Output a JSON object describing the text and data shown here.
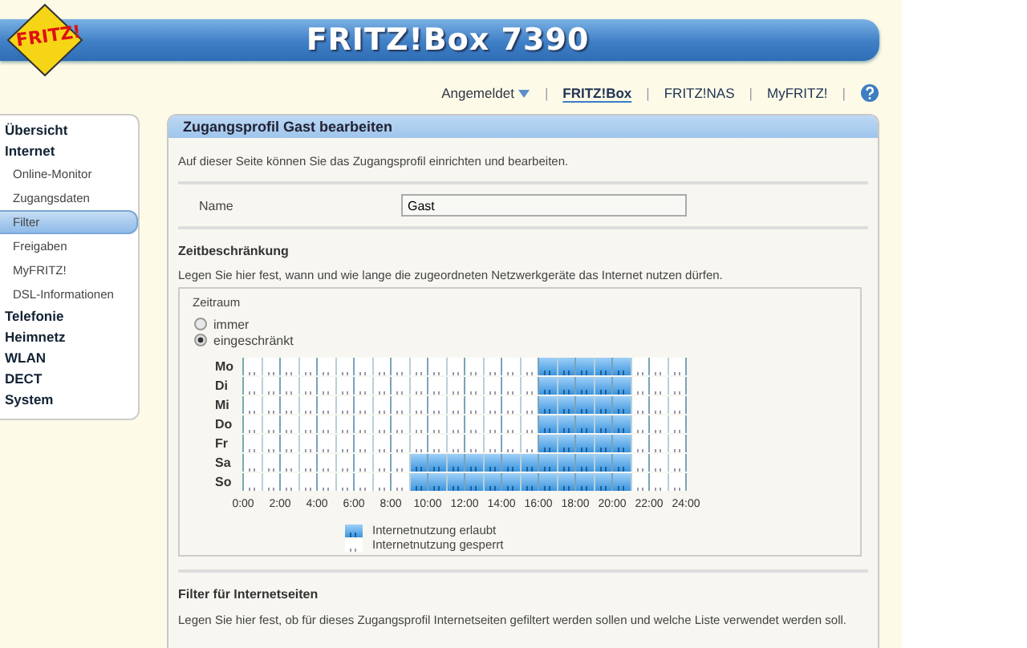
{
  "header": {
    "logo": "FRITZ!",
    "title": "FRITZ!Box 7390"
  },
  "top_nav": {
    "account": "Angemeldet",
    "separators": [
      "|",
      "|",
      "|",
      "|"
    ],
    "links": [
      {
        "label": "FRITZ!Box",
        "selected": true
      },
      {
        "label": "FRITZ!NAS",
        "selected": false
      },
      {
        "label": "MyFRITZ!",
        "selected": false
      }
    ]
  },
  "sidebar": {
    "items": [
      {
        "label": "Übersicht",
        "selected": false
      },
      {
        "label": "Internet",
        "selected": false,
        "children": [
          {
            "label": "Online-Monitor",
            "selected": false
          },
          {
            "label": "Zugangsdaten",
            "selected": false
          },
          {
            "label": "Filter",
            "selected": true
          },
          {
            "label": "Freigaben",
            "selected": false
          },
          {
            "label": "MyFRITZ!",
            "selected": false
          },
          {
            "label": "DSL-Informationen",
            "selected": false
          }
        ]
      },
      {
        "label": "Telefonie",
        "selected": false
      },
      {
        "label": "Heimnetz",
        "selected": false
      },
      {
        "label": "WLAN",
        "selected": false
      },
      {
        "label": "DECT",
        "selected": false
      },
      {
        "label": "System",
        "selected": false
      }
    ]
  },
  "panel": {
    "title": "Zugangsprofil Gast bearbeiten",
    "intro": "Auf dieser Seite können Sie das Zugangsprofil einrichten und bearbeiten.",
    "name_field": {
      "label": "Name",
      "value": "Gast"
    },
    "time_section": {
      "heading": "Zeitbeschränkung",
      "description": "Legen Sie hier fest, wann und wie lange die zugeordneten Netzwerkgeräte das Internet nutzen dürfen.",
      "period_label": "Zeitraum",
      "options": [
        {
          "label": "immer",
          "selected": false
        },
        {
          "label": "eingeschränkt",
          "selected": true
        }
      ],
      "days": [
        {
          "day": "Mo",
          "slots": [
            false,
            false,
            false,
            false,
            false,
            false,
            false,
            false,
            false,
            false,
            false,
            false,
            false,
            false,
            false,
            false,
            true,
            true,
            true,
            true,
            true,
            false,
            false,
            false
          ]
        },
        {
          "day": "Di",
          "slots": [
            false,
            false,
            false,
            false,
            false,
            false,
            false,
            false,
            false,
            false,
            false,
            false,
            false,
            false,
            false,
            false,
            true,
            true,
            true,
            true,
            true,
            false,
            false,
            false
          ]
        },
        {
          "day": "Mi",
          "slots": [
            false,
            false,
            false,
            false,
            false,
            false,
            false,
            false,
            false,
            false,
            false,
            false,
            false,
            false,
            false,
            false,
            true,
            true,
            true,
            true,
            true,
            false,
            false,
            false
          ]
        },
        {
          "day": "Do",
          "slots": [
            false,
            false,
            false,
            false,
            false,
            false,
            false,
            false,
            false,
            false,
            false,
            false,
            false,
            false,
            false,
            false,
            true,
            true,
            true,
            true,
            true,
            false,
            false,
            false
          ]
        },
        {
          "day": "Fr",
          "slots": [
            false,
            false,
            false,
            false,
            false,
            false,
            false,
            false,
            false,
            false,
            false,
            false,
            false,
            false,
            false,
            false,
            true,
            true,
            true,
            true,
            true,
            false,
            false,
            false
          ]
        },
        {
          "day": "Sa",
          "slots": [
            false,
            false,
            false,
            false,
            false,
            false,
            false,
            false,
            false,
            true,
            true,
            true,
            true,
            true,
            true,
            true,
            true,
            true,
            true,
            true,
            true,
            false,
            false,
            false
          ]
        },
        {
          "day": "So",
          "slots": [
            false,
            false,
            false,
            false,
            false,
            false,
            false,
            false,
            false,
            true,
            true,
            true,
            true,
            true,
            true,
            true,
            true,
            true,
            true,
            true,
            true,
            false,
            false,
            false
          ]
        }
      ],
      "hours": [
        "0:00",
        "2:00",
        "4:00",
        "6:00",
        "8:00",
        "10:00",
        "12:00",
        "14:00",
        "16:00",
        "18:00",
        "20:00",
        "22:00",
        "24:00"
      ],
      "legend": [
        {
          "label": "Internetnutzung erlaubt",
          "allowed": true
        },
        {
          "label": "Internetnutzung gesperrt",
          "allowed": false
        }
      ]
    },
    "filter_section": {
      "heading": "Filter für Internetseiten",
      "description": "Legen Sie hier fest, ob für dieses Zugangsprofil Internetseiten gefiltert werden sollen und welche Liste verwendet werden soll."
    }
  }
}
